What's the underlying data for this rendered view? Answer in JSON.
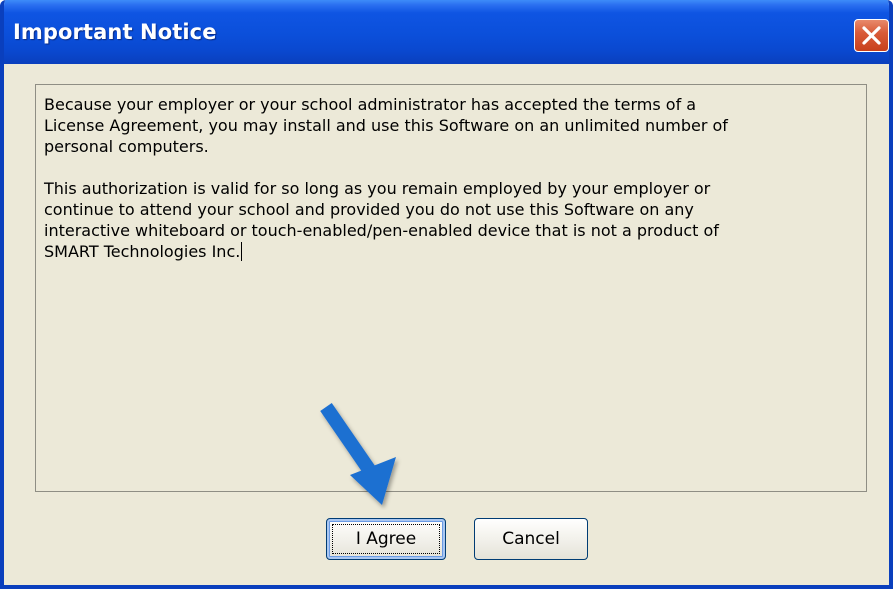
{
  "window": {
    "title": "Important Notice",
    "close_icon": "close-x-icon"
  },
  "notice": {
    "paragraph1": "Because your employer or your school administrator has accepted the terms of a\nLicense Agreement, you may install and use this Software on an unlimited number of\npersonal computers.",
    "paragraph2": "This authorization is valid for so long as you remain employed by your employer or\ncontinue to attend your school and provided you do not use this Software on any\ninteractive whiteboard or touch-enabled/pen-enabled device that is not a product of\nSMART Technologies Inc."
  },
  "buttons": {
    "agree_label": "I Agree",
    "cancel_label": "Cancel"
  },
  "annotation": {
    "arrow_icon": "pointer-arrow-icon",
    "arrow_color": "#1f6fd1"
  },
  "colors": {
    "titlebar": "#0b4fda",
    "dialog_background": "#ece9d8",
    "close_button": "#d95c3a"
  }
}
